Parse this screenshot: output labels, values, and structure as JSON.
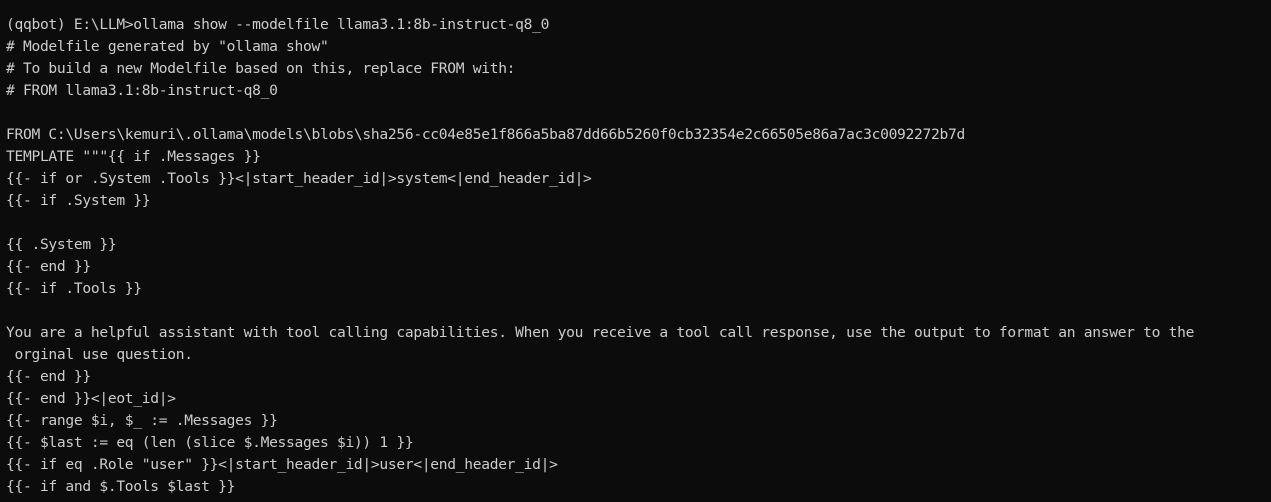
{
  "terminal": {
    "lines": [
      "(qqbot) E:\\LLM>ollama show --modelfile llama3.1:8b-instruct-q8_0",
      "# Modelfile generated by \"ollama show\"",
      "# To build a new Modelfile based on this, replace FROM with:",
      "# FROM llama3.1:8b-instruct-q8_0",
      "",
      "FROM C:\\Users\\kemuri\\.ollama\\models\\blobs\\sha256-cc04e85e1f866a5ba87dd66b5260f0cb32354e2c66505e86a7ac3c0092272b7d",
      "TEMPLATE \"\"\"{{ if .Messages }}",
      "{{- if or .System .Tools }}<|start_header_id|>system<|end_header_id|>",
      "{{- if .System }}",
      "",
      "{{ .System }}",
      "{{- end }}",
      "{{- if .Tools }}",
      "",
      "You are a helpful assistant with tool calling capabilities. When you receive a tool call response, use the output to format an answer to the",
      " orginal use question.",
      "{{- end }}",
      "{{- end }}<|eot_id|>",
      "{{- range $i, $_ := .Messages }}",
      "{{- $last := eq (len (slice $.Messages $i)) 1 }}",
      "{{- if eq .Role \"user\" }}<|start_header_id|>user<|end_header_id|>",
      "{{- if and $.Tools $last }}"
    ]
  }
}
